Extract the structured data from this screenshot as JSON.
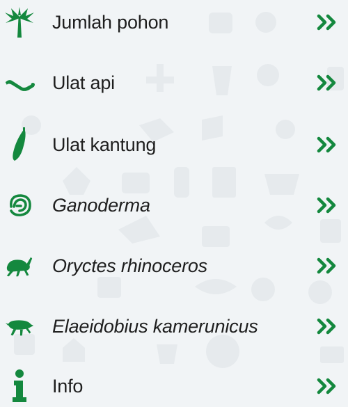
{
  "theme": {
    "accent": "#14883e",
    "text": "#1e1e1e",
    "background": "#f1f4f6"
  },
  "menu": {
    "items": [
      {
        "label": "Jumlah pohon",
        "icon": "palm-tree-icon",
        "italic": false
      },
      {
        "label": "Ulat api",
        "icon": "caterpillar-icon",
        "italic": false
      },
      {
        "label": "Ulat kantung",
        "icon": "bagworm-icon",
        "italic": false
      },
      {
        "label": "Ganoderma",
        "icon": "fungus-icon",
        "italic": true
      },
      {
        "label": "Oryctes rhinoceros",
        "icon": "rhinoceros-beetle-icon",
        "italic": true
      },
      {
        "label": "Elaeidobius kamerunicus",
        "icon": "weevil-icon",
        "italic": true
      },
      {
        "label": "Info",
        "icon": "info-icon",
        "italic": false
      }
    ],
    "chevron_icon": "double-chevron-right-icon"
  }
}
